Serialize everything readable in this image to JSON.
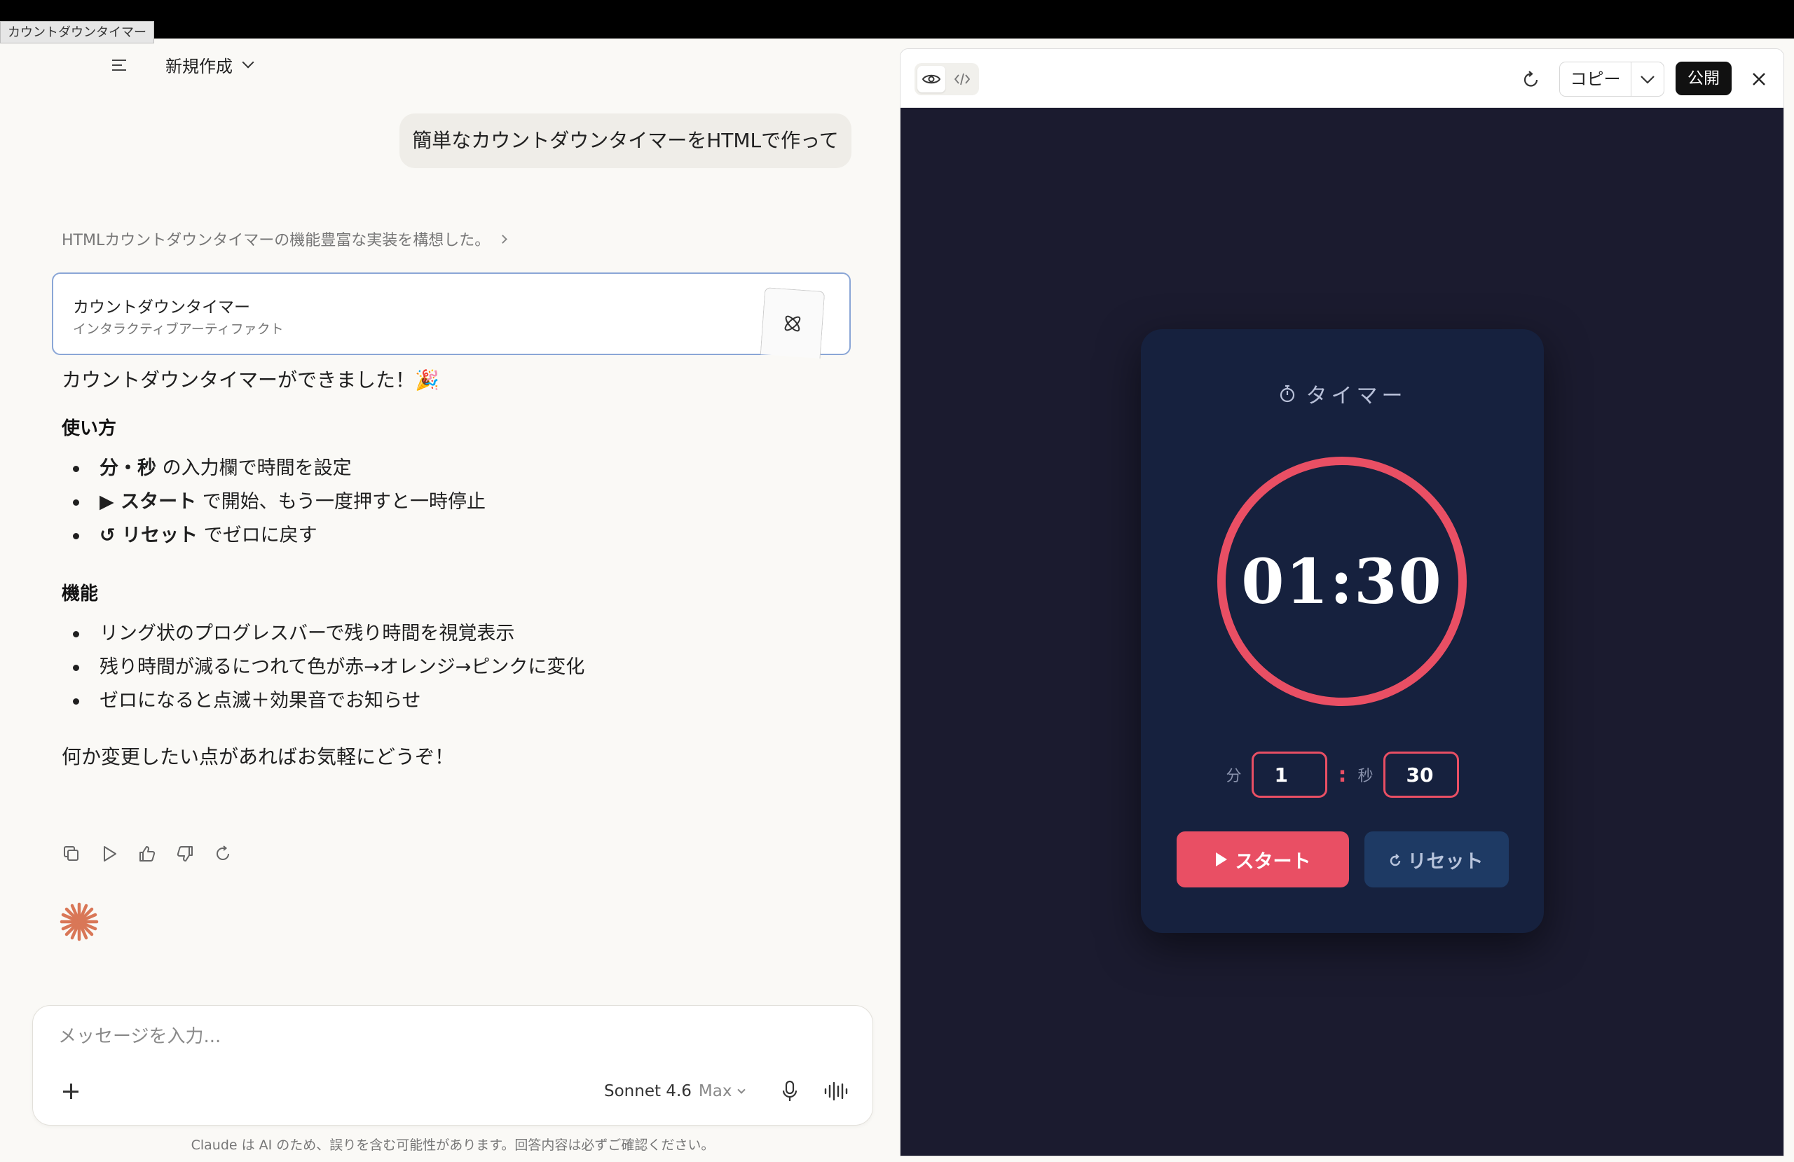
{
  "window": {
    "title": "カウントダウンタイマー"
  },
  "header": {
    "new_chat_label": "新規作成"
  },
  "chat": {
    "user_message": "簡単なカウントダウンタイマーをHTMLで作って",
    "thinking_summary": "HTMLカウントダウンタイマーの機能豊富な実装を構想した。",
    "artifact": {
      "title": "カウントダウンタイマー",
      "subtitle": "インタラクティブアーティファクト"
    },
    "reply": {
      "intro": "カウントダウンタイマーができました！🎉",
      "usage_heading": "使い方",
      "usage_items": [
        {
          "bold": "分・秒",
          "rest": " の入力欄で時間を設定"
        },
        {
          "bold": "▶ スタート",
          "rest": " で開始、もう一度押すと一時停止"
        },
        {
          "bold": "↺ リセット",
          "rest": " でゼロに戻す"
        }
      ],
      "features_heading": "機能",
      "feature_items": [
        "リング状のプログレスバーで残り時間を視覚表示",
        "残り時間が減るにつれて色が赤→オレンジ→ピンクに変化",
        "ゼロになると点滅＋効果音でお知らせ"
      ],
      "closing": "何か変更したい点があればお気軽にどうぞ！"
    }
  },
  "composer": {
    "placeholder": "メッセージを入力...",
    "model": "Sonnet 4.6",
    "mode": "Max",
    "disclaimer": "Claude は AI のため、誤りを含む可能性があります。回答内容は必ずご確認ください。"
  },
  "artifact_panel": {
    "copy_label": "コピー",
    "publish_label": "公開",
    "timer": {
      "heading": "タイマー",
      "display": "01:30",
      "minutes_label": "分",
      "minutes_value": "1",
      "colon": ":",
      "seconds_label": "秒",
      "seconds_value": "30",
      "start_label": "スタート",
      "reset_label": "リセット",
      "ring_progress": 1.0,
      "accent_color": "#e94f64"
    }
  },
  "colors": {
    "app_bg": "#faf9f6",
    "preview_bg": "#1b1b2f",
    "card_bg": "#16213e",
    "accent": "#e94f64",
    "reset_bg": "#1e3a64",
    "claude_orange": "#d97757"
  }
}
